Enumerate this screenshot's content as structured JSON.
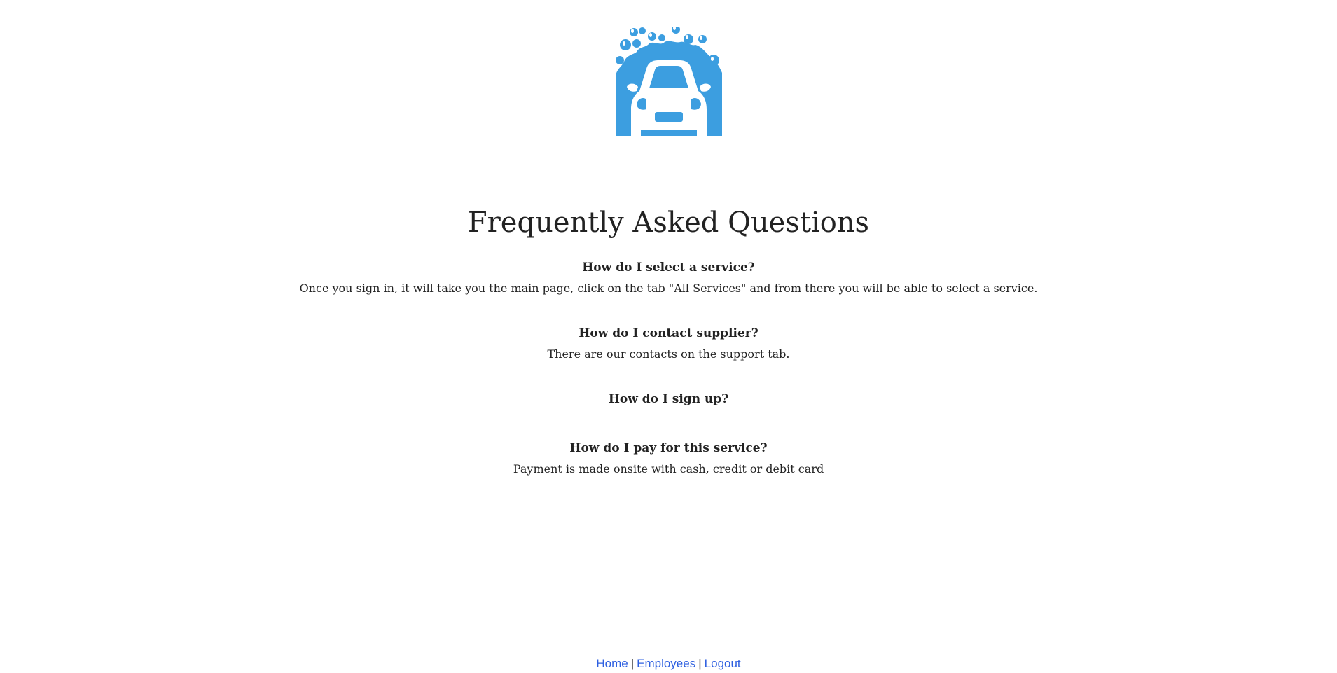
{
  "brand": {
    "logo_icon": "car-wash-logo-icon",
    "logo_color": "#3c9ee0"
  },
  "page": {
    "title": "Frequently Asked Questions"
  },
  "faq": [
    {
      "question": "How do I select a service?",
      "answer": "Once you sign in, it will take you the main page, click on the tab \"All Services\" and from there you will be able to select a service."
    },
    {
      "question": "How do I contact supplier?",
      "answer": "There are our contacts on the support tab."
    },
    {
      "question": "How do I sign up?",
      "answer": ""
    },
    {
      "question": "How do I pay for this service?",
      "answer": "Payment is made onsite with cash, credit or debit card"
    }
  ],
  "footer": {
    "links": [
      "Home",
      "Employees",
      "Logout"
    ],
    "separator": "|",
    "link_color": "#2d5fe0"
  }
}
